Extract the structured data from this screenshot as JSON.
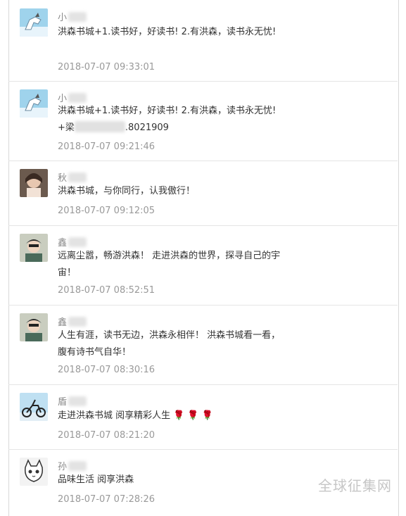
{
  "comments": [
    {
      "name": "小",
      "text": "洪森书城+1.读书好，好读书! 2.有洪森，读书永无忧!",
      "time": "2018-07-07 09:33:01"
    },
    {
      "name": "小",
      "text_before": "洪森书城+1.读书好，好读书! 2.有洪森，读书永无忧!+梁",
      "text_after": ".8021909",
      "time": "2018-07-07 09:21:46"
    },
    {
      "name": "秋",
      "text": "洪森书城，与你同行，认我傲行！",
      "time": "2018-07-07 09:12:05"
    },
    {
      "name": "鑫",
      "text": "远离尘嚣，畅游洪森！ 走进洪森的世界，探寻自己的宇宙！",
      "time": "2018-07-07 08:52:51"
    },
    {
      "name": "鑫",
      "text": "人生有涯，读书无边，洪森永相伴！ 洪森书城看一看，腹有诗书气自华！",
      "time": "2018-07-07 08:30:16"
    },
    {
      "name": "盾",
      "text": "走进洪森书城 阅享精彩人生",
      "time": "2018-07-07 08:21:20",
      "emoji": "rose-icon"
    },
    {
      "name": "孙",
      "text": "品味生活 阅享洪森",
      "time": "2018-07-07 07:28:26"
    }
  ],
  "watermark": "全球征集网",
  "colors": {
    "name": "#888888",
    "text": "#333333",
    "time": "#999999",
    "divider": "#e5e5e5"
  }
}
